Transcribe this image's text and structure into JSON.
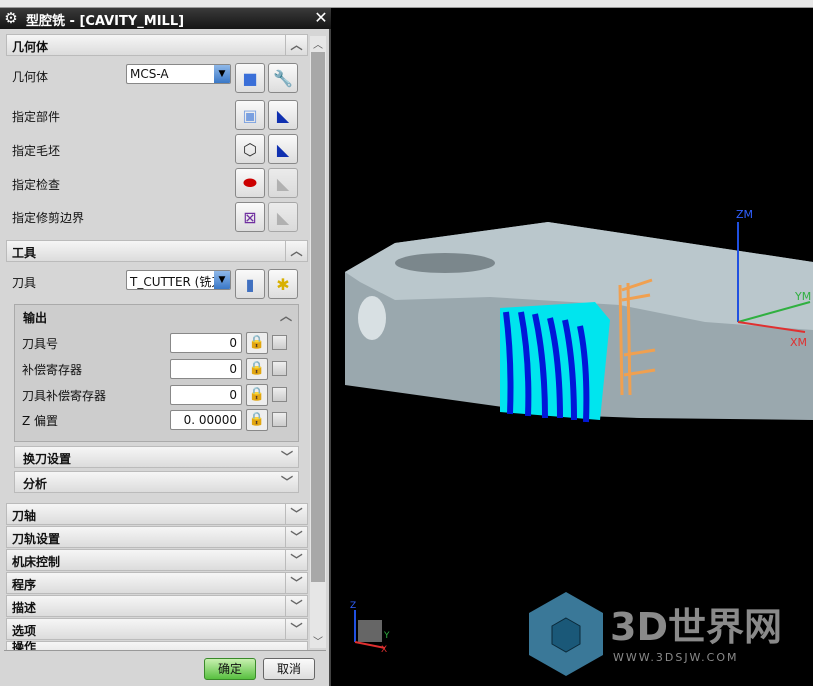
{
  "dialog": {
    "title": "型腔铣 - [CAVITY_MILL]",
    "icon": "gear-icon",
    "close_icon": "close-icon"
  },
  "geometry": {
    "header": "几何体",
    "rows": [
      {
        "label": "几何体",
        "value": "MCS-A",
        "buttons": [
          "new-geometry-icon",
          "edit-wrench-icon"
        ]
      },
      {
        "label": "指定部件",
        "buttons": [
          "part-icon",
          "flashlight-icon"
        ]
      },
      {
        "label": "指定毛坯",
        "buttons": [
          "blank-box-icon",
          "flashlight-icon"
        ]
      },
      {
        "label": "指定检查",
        "buttons": [
          "check-icon",
          "flashlight-disabled-icon"
        ]
      },
      {
        "label": "指定修剪边界",
        "buttons": [
          "trim-boundary-icon",
          "flashlight-disabled-icon"
        ]
      }
    ]
  },
  "tool": {
    "header": "工具",
    "label": "刀具",
    "value": "T_CUTTER (铣刀",
    "output": {
      "header": "输出",
      "rows": [
        {
          "label": "刀具号",
          "value": "0"
        },
        {
          "label": "补偿寄存器",
          "value": "0"
        },
        {
          "label": "刀具补偿寄存器",
          "value": "0"
        },
        {
          "label": "Z 偏置",
          "value": "0. 00000"
        }
      ]
    },
    "tool_change": "换刀设置",
    "analysis": "分析"
  },
  "sections": [
    "刀轴",
    "刀轨设置",
    "机床控制",
    "程序",
    "描述",
    "选项",
    "操作"
  ],
  "buttons": {
    "ok": "确定",
    "cancel": "取消"
  },
  "viewport": {
    "axes": {
      "z": "ZM",
      "y": "YM",
      "x": "XM"
    },
    "triad": {
      "z": "Z",
      "y": "Y",
      "x": "X"
    },
    "watermark": {
      "name": "3D世界网",
      "url": "WWW.3DSJW.COM"
    },
    "colors": {
      "part": "#b9c6cc",
      "toolpath_light": "#00e5ee",
      "toolpath_dark": "#0018d8",
      "tool": "#f0a050"
    }
  }
}
